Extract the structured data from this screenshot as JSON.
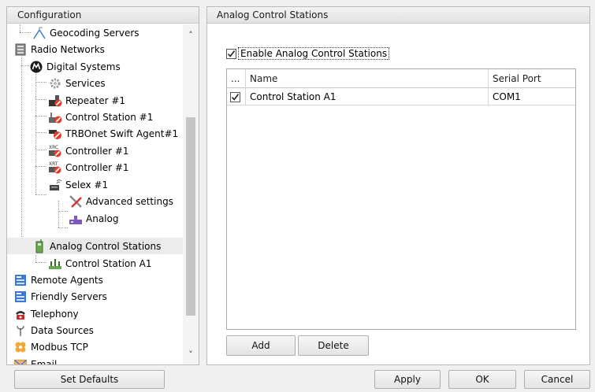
{
  "left_panel": {
    "title": "Configuration",
    "tree": [
      {
        "label": "Geocoding Servers",
        "icon": "geocoding-icon"
      },
      {
        "label": "Radio Networks",
        "icon": "server-icon"
      },
      {
        "label": "Digital Systems",
        "icon": "motorola-icon"
      },
      {
        "label": "Services",
        "icon": "gear-icon"
      },
      {
        "label": "Repeater #1",
        "icon": "repeater-icon"
      },
      {
        "label": "Control Station #1",
        "icon": "control-station-icon"
      },
      {
        "label": "TRBOnet Swift Agent#1",
        "icon": "agent-icon"
      },
      {
        "label": "Controller #1",
        "icon": "controller-icon"
      },
      {
        "label": "Controller #1",
        "icon": "controller-icon"
      },
      {
        "label": "Selex #1",
        "icon": "selex-icon"
      },
      {
        "label": "Advanced settings",
        "icon": "tools-icon"
      },
      {
        "label": "Analog",
        "icon": "analog-icon"
      },
      {
        "label": "Analog Control Stations",
        "icon": "radio-icon"
      },
      {
        "label": "Control Station A1",
        "icon": "network-icon"
      },
      {
        "label": "Remote Agents",
        "icon": "remote-agents-icon"
      },
      {
        "label": "Friendly Servers",
        "icon": "friendly-servers-icon"
      },
      {
        "label": "Telephony",
        "icon": "telephone-icon"
      },
      {
        "label": "Data Sources",
        "icon": "antenna-icon"
      },
      {
        "label": "Modbus TCP",
        "icon": "modbus-icon"
      },
      {
        "label": "Email",
        "icon": "email-icon"
      }
    ],
    "selected_index": 12,
    "set_defaults_label": "Set Defaults"
  },
  "right_panel": {
    "title": "Analog Control Stations",
    "enable_label": "Enable Analog Control Stations",
    "enable_checked": true,
    "grid": {
      "columns": [
        "...",
        "Name",
        "Serial Port"
      ],
      "rows": [
        {
          "checked": true,
          "name": "Control Station A1",
          "serial_port": "COM1"
        }
      ]
    },
    "add_label": "Add",
    "delete_label": "Delete"
  },
  "footer": {
    "apply_label": "Apply",
    "ok_label": "OK",
    "cancel_label": "Cancel"
  },
  "colors": {
    "panel_header_bg": "#e6e6e6",
    "selection_bg": "#e8e8e8",
    "window_bg": "#f0f0f0"
  }
}
